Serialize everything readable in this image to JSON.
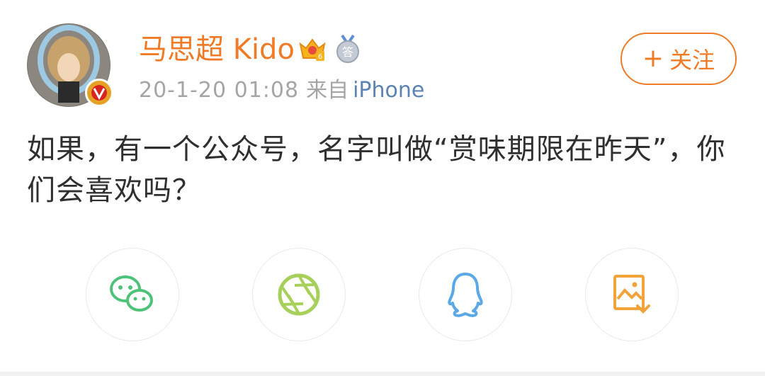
{
  "post": {
    "username": "马思超 Kido",
    "timestamp": "20-1-20 01:08",
    "source_prefix": "来自",
    "source": "iPhone",
    "text": "如果，有一个公众号，名字叫做“赏味期限在昨天”，你们会喜欢吗？"
  },
  "follow_button": {
    "label": "关注"
  },
  "badges": [
    "crown-vip-badge",
    "medal-answer-badge"
  ],
  "badge_text": {
    "medal": "答"
  },
  "share": [
    {
      "name": "wechat-icon",
      "color": "#4fc27a"
    },
    {
      "name": "wechat-moments-icon",
      "color": "#a6d05a"
    },
    {
      "name": "qq-icon",
      "color": "#5aa9e6"
    },
    {
      "name": "save-image-icon",
      "color": "#f2a33a"
    }
  ],
  "colors": {
    "accent": "#f07b26",
    "link": "#5b83b5",
    "meta": "#a5a5a5",
    "text": "#2f2f2f"
  }
}
